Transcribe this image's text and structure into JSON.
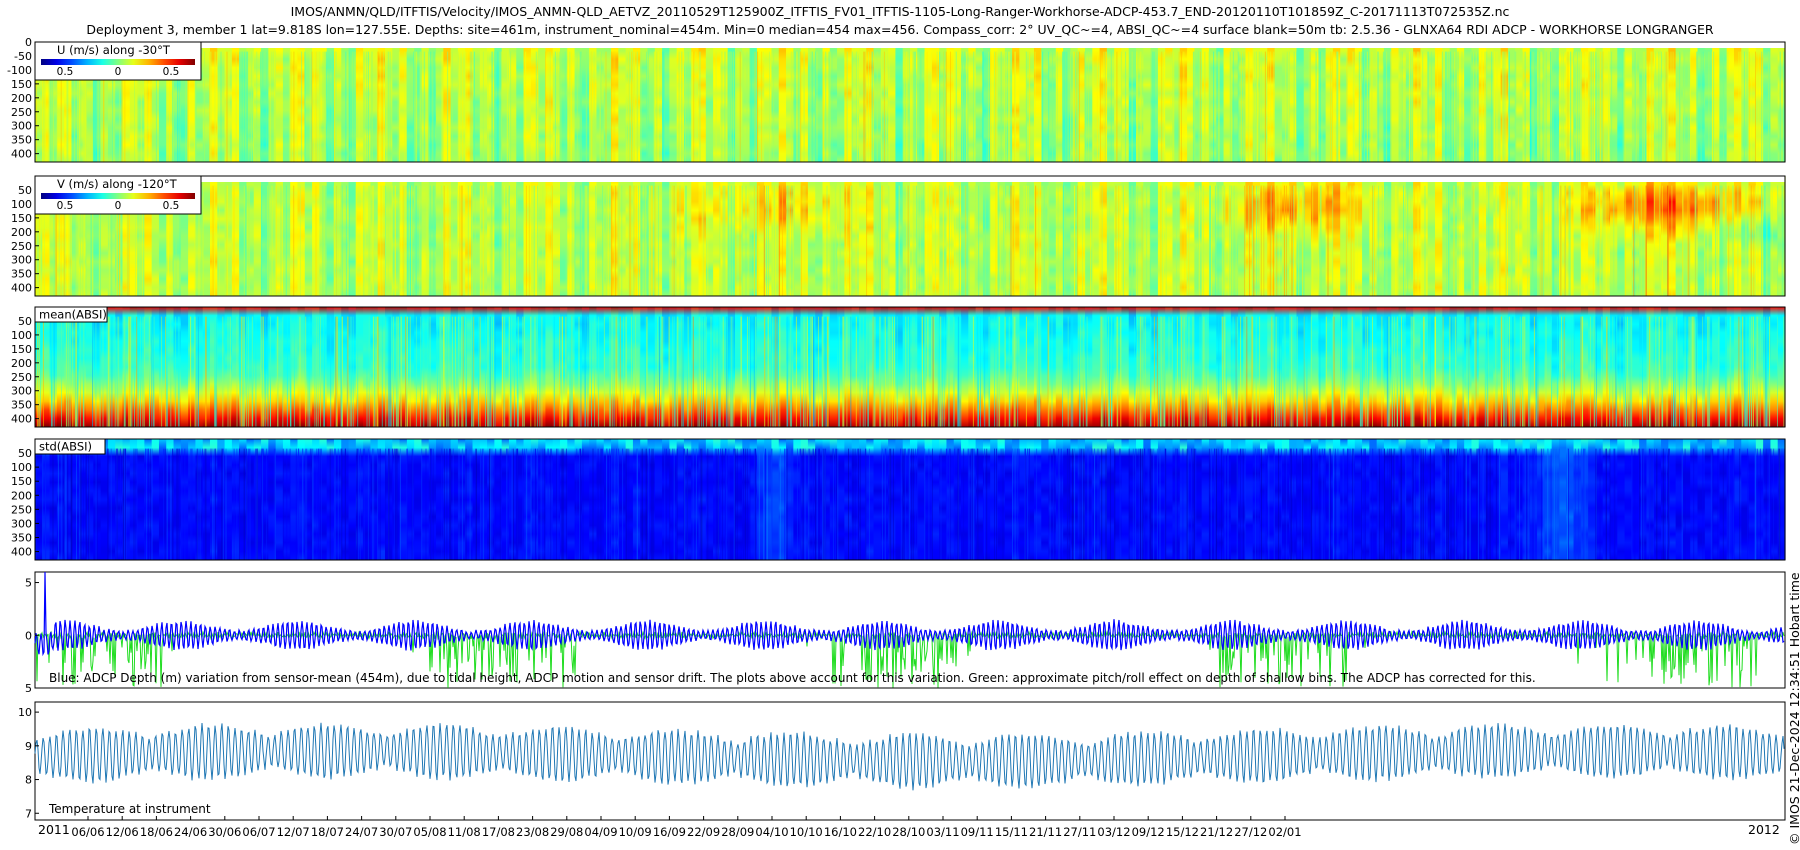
{
  "titles": {
    "line1": "IMOS/ANMN/QLD/ITFTIS/Velocity/IMOS_ANMN-QLD_AETVZ_20110529T125900Z_ITFTIS_FV01_ITFTIS-1105-Long-Ranger-Workhorse-ADCP-453.7_END-20120110T101859Z_C-20171113T072535Z.nc",
    "line2": "Deployment 3, member 1 lat=9.818S lon=127.55E. Depths: site=461m, instrument_nominal=454m. Min=0 median=454 max=456. Compass_corr: 2° UV_QC~=4, ABSI_QC~=4 surface blank=50m tb: 2.5.36 - GLNXA64 RDI ADCP - WORKHORSE LONGRANGER"
  },
  "side_label": "© IMOS 21-Dec-2024 12:34:51 Hobart time",
  "colors": {
    "depth_line": "#0000ff",
    "pitch_roll": "#22dd22",
    "temperature": "#1f77b4"
  },
  "chart_data": [
    {
      "type": "heatmap",
      "panel": "U",
      "label": "U (m/s) along -30°T",
      "colorbar_ticks": [
        "0.5",
        "0",
        "0.5"
      ],
      "y_ticks": [
        "0",
        "-50",
        "-100",
        "150",
        "200",
        "250",
        "300",
        "350",
        "400"
      ],
      "ylim": [
        0,
        430
      ],
      "character": "mostly green/yellow vertical tidal striping with cyan streaks"
    },
    {
      "type": "heatmap",
      "panel": "V",
      "label": "V (m/s) along -120°T",
      "colorbar_ticks": [
        "0.5",
        "0",
        "0.5"
      ],
      "y_ticks": [
        "50",
        "100",
        "150",
        "200",
        "250",
        "300",
        "350",
        "400"
      ],
      "ylim": [
        0,
        430
      ],
      "character": "green/yellow with orange patches in upper layer late in record"
    },
    {
      "type": "heatmap",
      "panel": "mean(ABSI)",
      "label": "mean(ABSI)",
      "y_ticks": [
        "50",
        "100",
        "150",
        "200",
        "250",
        "300",
        "350",
        "400"
      ],
      "ylim": [
        0,
        430
      ],
      "character": "red near surface, cyan/green mid-depth, orange/red near bottom"
    },
    {
      "type": "heatmap",
      "panel": "std(ABSI)",
      "label": "std(ABSI)",
      "y_ticks": [
        "50",
        "100",
        "150",
        "200",
        "250",
        "300",
        "350",
        "400"
      ],
      "ylim": [
        0,
        430
      ],
      "character": "dark blue throughout, lighter cyan near surface"
    },
    {
      "type": "line",
      "panel": "depth",
      "y_ticks": [
        "5",
        "0",
        "5"
      ],
      "ylim": [
        -5,
        6
      ],
      "annotation": "Blue: ADCP Depth (m) variation from sensor-mean (454m), due to tidal height, ADCP motion and sensor drift. The plots above account for this variation. Green: approximate pitch/roll effect on depth of shallow bins. The ADCP has corrected for this.",
      "series": [
        {
          "values_summary": "tidal oscillation about 0 with amplitude about 1-2, spike to 6 near start"
        },
        {
          "values_summary": "near 0 with frequent downward excursions to -5"
        }
      ]
    },
    {
      "type": "line",
      "panel": "temperature",
      "y_ticks": [
        "10",
        "9",
        "8",
        "7"
      ],
      "ylim": [
        6.8,
        10.3
      ],
      "annotation": "Temperature at instrument",
      "series": [
        {
          "values_summary": "oscillates between about 7.5 and 10 with ~14-day envelope modulation"
        }
      ]
    }
  ],
  "x_axis": {
    "start_year": "2011",
    "end_year": "2012",
    "ticks": [
      "06/06",
      "12/06",
      "18/06",
      "24/06",
      "30/06",
      "06/07",
      "12/07",
      "18/07",
      "24/07",
      "30/07",
      "05/08",
      "11/08",
      "17/08",
      "23/08",
      "29/08",
      "04/09",
      "10/09",
      "16/09",
      "22/09",
      "28/09",
      "04/10",
      "10/10",
      "16/10",
      "22/10",
      "28/10",
      "03/11",
      "09/11",
      "15/11",
      "21/11",
      "27/11",
      "03/12",
      "09/12",
      "15/12",
      "21/12",
      "27/12",
      "02/01"
    ]
  }
}
